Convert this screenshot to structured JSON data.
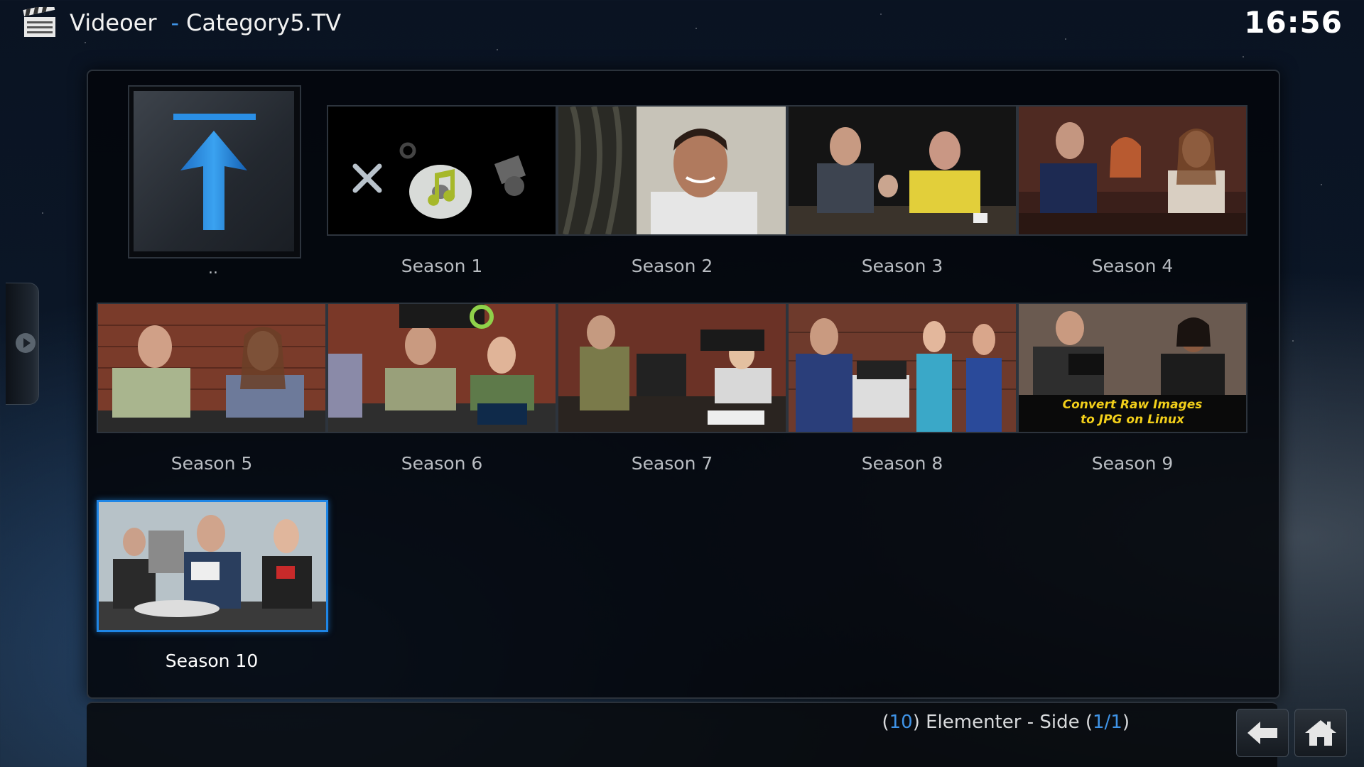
{
  "header": {
    "section": "Videoer",
    "separator": "-",
    "source": "Category5.TV",
    "clock": "16:56"
  },
  "parent": {
    "label": ".."
  },
  "seasons": [
    {
      "label": "Season 1"
    },
    {
      "label": "Season 2"
    },
    {
      "label": "Season 3"
    },
    {
      "label": "Season 4"
    },
    {
      "label": "Season 5"
    },
    {
      "label": "Season 6"
    },
    {
      "label": "Season 7"
    },
    {
      "label": "Season 8"
    },
    {
      "label": "Season 9",
      "caption_line1": "Convert Raw Images",
      "caption_line2": "to JPG on Linux"
    },
    {
      "label": "Season 10"
    }
  ],
  "focused_index": 9,
  "footer": {
    "count_open": "(",
    "count_value": "10",
    "count_middle": ") Elementer - Side (",
    "page_value": "1/1",
    "count_close": ")"
  },
  "colors": {
    "accent": "#1f86e6",
    "highlight_text": "#3f93e6"
  },
  "icons": {
    "app": "movie-clapperboard-icon",
    "parent": "up-arrow-icon",
    "back": "back-arrow-icon",
    "home": "home-icon"
  }
}
